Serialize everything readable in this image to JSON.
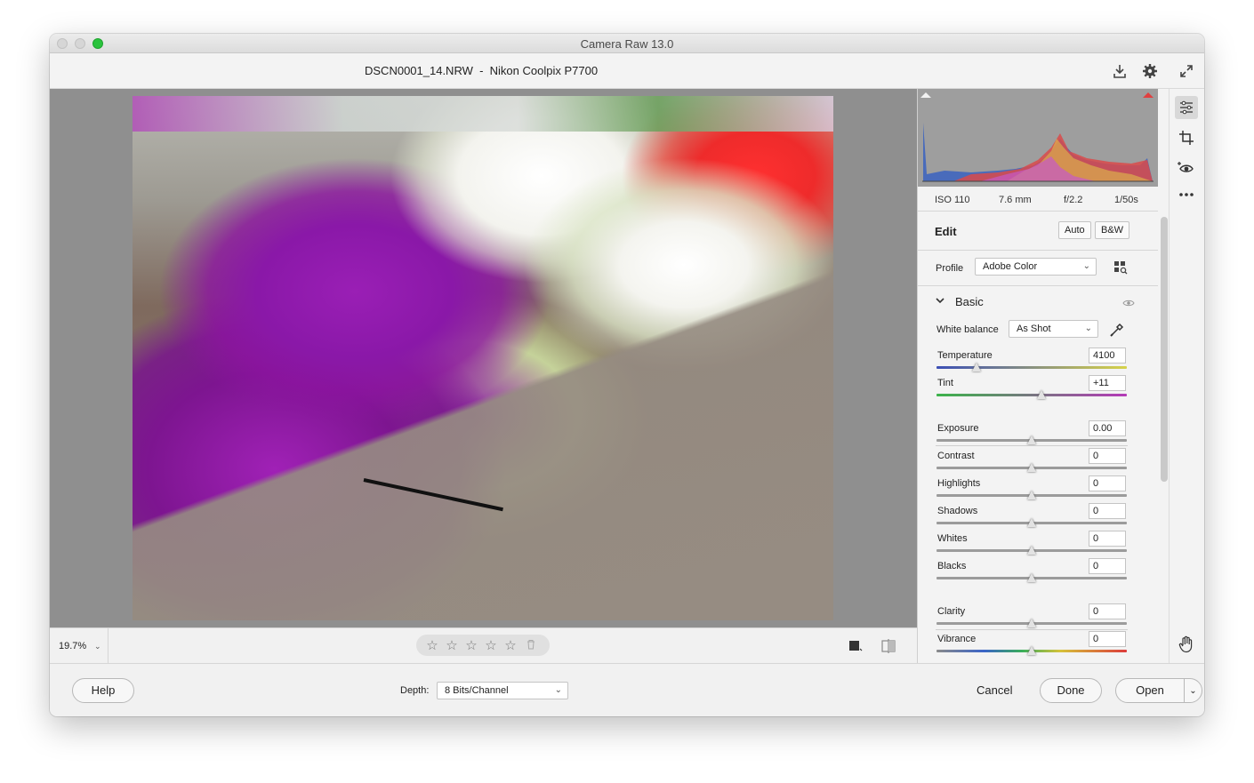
{
  "window": {
    "title": "Camera Raw 13.0",
    "file_title": "DSCN0001_14.NRW  -  Nikon Coolpix P7700"
  },
  "exif": {
    "iso": "ISO 110",
    "focal": "7.6 mm",
    "aperture": "f/2.2",
    "shutter": "1/50s"
  },
  "edit": {
    "title": "Edit",
    "auto_label": "Auto",
    "bw_label": "B&W"
  },
  "profile": {
    "label": "Profile",
    "value": "Adobe Color"
  },
  "basic": {
    "title": "Basic",
    "white_balance_label": "White balance",
    "white_balance_value": "As Shot",
    "sliders": [
      {
        "label": "Temperature",
        "value": "4100",
        "position": 0.21
      },
      {
        "label": "Tint",
        "value": "+11",
        "position": 0.55
      },
      {
        "label": "Exposure",
        "value": "0.00",
        "position": 0.5
      },
      {
        "label": "Contrast",
        "value": "0",
        "position": 0.5
      },
      {
        "label": "Highlights",
        "value": "0",
        "position": 0.5
      },
      {
        "label": "Shadows",
        "value": "0",
        "position": 0.5
      },
      {
        "label": "Whites",
        "value": "0",
        "position": 0.5
      },
      {
        "label": "Blacks",
        "value": "0",
        "position": 0.5
      },
      {
        "label": "Clarity",
        "value": "0",
        "position": 0.5
      },
      {
        "label": "Vibrance",
        "value": "0",
        "position": 0.5
      }
    ]
  },
  "bottom": {
    "zoom": "19.7%",
    "rating_stars": 5
  },
  "footer": {
    "help_label": "Help",
    "depth_label": "Depth:",
    "depth_value": "8 Bits/Channel",
    "cancel_label": "Cancel",
    "done_label": "Done",
    "open_label": "Open"
  },
  "icons": {
    "save": "download-icon",
    "settings": "gear-icon",
    "fullscreen": "expand-icon",
    "edit_tool": "sliders-icon",
    "crop_tool": "crop-icon",
    "redeye_tool": "redeye-icon",
    "more": "more-icon",
    "hand": "hand-icon"
  },
  "colors": {
    "traffic_green": "#2ac33d",
    "histogram_bg": "#9e9e9e"
  }
}
